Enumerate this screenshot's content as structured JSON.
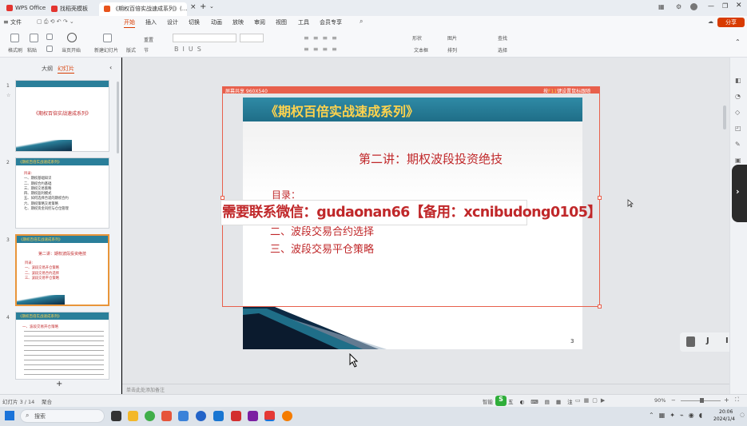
{
  "tabs": [
    {
      "label": "WPS Office"
    },
    {
      "label": "找稻壳模板"
    },
    {
      "label": "《期权百倍实战速成系列》(…"
    }
  ],
  "menu": [
    "文件",
    "开始",
    "插入",
    "设计",
    "切换",
    "动画",
    "放映",
    "审阅",
    "视图",
    "工具",
    "会员专享"
  ],
  "share_label": "分享",
  "ribbon": {
    "format_painter": "格式刷",
    "paste": "粘贴",
    "from_start": "当页开始",
    "new_slide": "新建幻灯片",
    "layout": "版式",
    "section": "节",
    "reset": "重置",
    "shape": "形状",
    "image": "图片",
    "textbox": "文本框",
    "arrange": "排列",
    "find": "查找",
    "select": "选择"
  },
  "panel": {
    "tab_outline": "大纲",
    "tab_slides": "幻灯片"
  },
  "thumbs": {
    "s1_title": "《期权百倍实战速成系列》",
    "s2_header": "《期权百倍实战速成系列》",
    "s2_lines": [
      "目录:",
      "一、期权基础知识",
      "二、期权合约基础",
      "三、期权交易策略",
      "四、期权盈利模式",
      "五、如何选择合适的期权合约",
      "六、期权策略交易策略",
      "七、期权资金风控与仓位管理"
    ],
    "s3_header": "《期权百倍实战速成系列》",
    "s3_title": "第二讲：期权波段投资绝技",
    "s3_lines": [
      "目录:",
      "一、波段交易开仓策略",
      "二、波段交易合约选择",
      "三、波段交易平仓策略"
    ],
    "s4_header": "《期权百倍实战速成系列》",
    "s4_title": "一、波段交易开仓策略",
    "numbers": [
      "1",
      "2",
      "3",
      "4"
    ]
  },
  "slide": {
    "overlay_left": "屏幕共享 960X540",
    "overlay_right_prefix": "按",
    "overlay_right_key": "F11",
    "overlay_right_suffix": "键设置鼠标跟随",
    "header_title": "《期权百倍实战速成系列》",
    "main_title": "第二讲：期权波段投资绝技",
    "toc_label": "目录：",
    "toc_items": [
      "二、波段交易合约选择",
      "三、波段交易平仓策略"
    ],
    "page_number": "3",
    "watermark": "需要联系微信：gudaonan66【备用：xcnibudong0105】"
  },
  "notes_placeholder": "单击此处添加备注",
  "status": {
    "slide_count": "幻灯片 3 / 14",
    "theme": "聚合",
    "smart": "智能",
    "zoom": "90%"
  },
  "taskbar": {
    "search_placeholder": "搜索",
    "time": "20:06",
    "date": "2024/1/4"
  },
  "float_toolbar": [
    "J",
    "I"
  ],
  "colors": {
    "accent": "#d83b01",
    "slide_header": "#2a7f9a",
    "header_text": "#ffd34d",
    "title_red": "#c0282a"
  }
}
